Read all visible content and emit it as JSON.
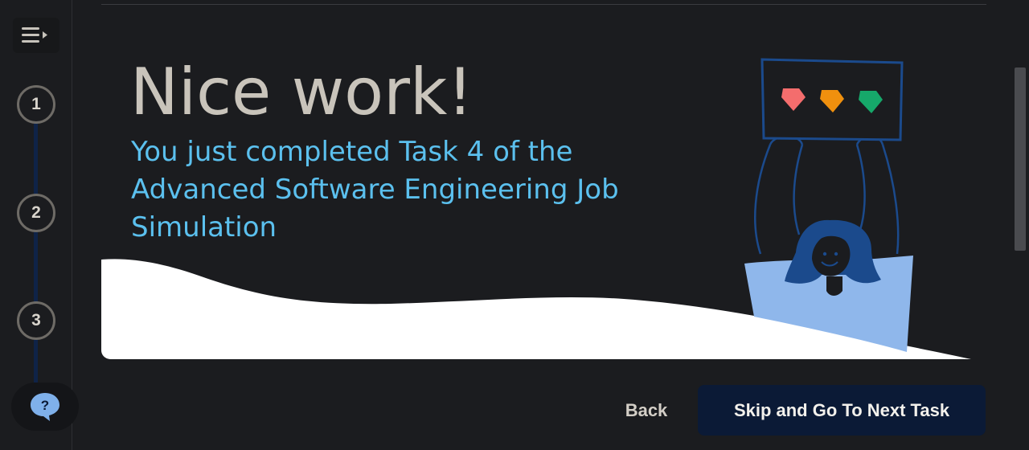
{
  "nav": {
    "menu_icon": "collapse-menu-icon",
    "steps": [
      {
        "number": "1"
      },
      {
        "number": "2"
      },
      {
        "number": "3"
      }
    ],
    "help_label": "?"
  },
  "main": {
    "title": "Nice work!",
    "subtitle": "You just completed Task 4 of the Advanced Software Engineering Job Simulation"
  },
  "footer": {
    "back_label": "Back",
    "next_label": "Skip and Go To Next Task"
  },
  "colors": {
    "background": "#1b1c1f",
    "title": "#c9c4bb",
    "subtitle_accent": "#5bc0ee",
    "primary_button": "#0b1a36",
    "gem_red": "#f46d6d",
    "gem_orange": "#f0900e",
    "gem_green": "#16a86a",
    "figure_blue": "#1b4a8c",
    "desk_blue": "#8fb7eb"
  }
}
